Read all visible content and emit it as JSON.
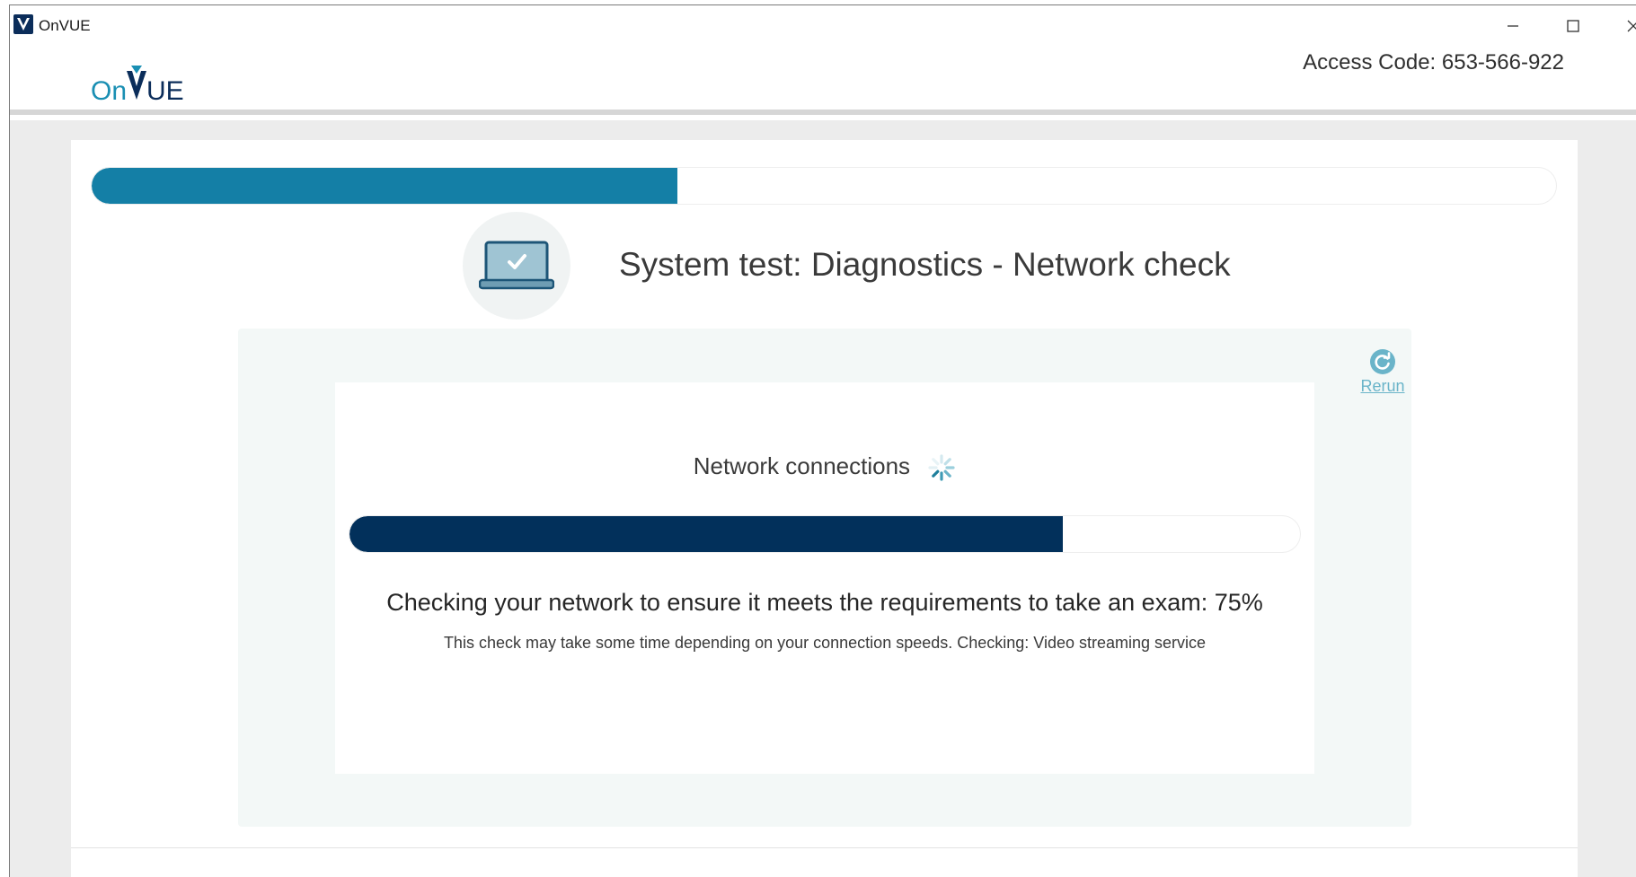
{
  "window": {
    "title": "OnVUE",
    "icon": "onvue-app-icon"
  },
  "header": {
    "logo_text": "OnVUE",
    "access_code": "Access Code: 653-566-922"
  },
  "overall_progress": {
    "percent": 40
  },
  "section": {
    "title": "System test: Diagnostics - Network check",
    "icon": "laptop-check-icon"
  },
  "panel": {
    "rerun_label": "Rerun",
    "check_title": "Network connections",
    "progress_percent": 75,
    "status_text": "Checking your network to ensure it meets the requirements to take an exam: 75%",
    "note_text": "This check may take some time depending on your connection speeds. Checking: Video streaming service"
  },
  "colors": {
    "overall_progress": "#147fa6",
    "check_progress": "#02305b",
    "rerun": "#6ab4c9",
    "brand_dark": "#0b2d5a",
    "brand_teal": "#1a8fb3"
  }
}
